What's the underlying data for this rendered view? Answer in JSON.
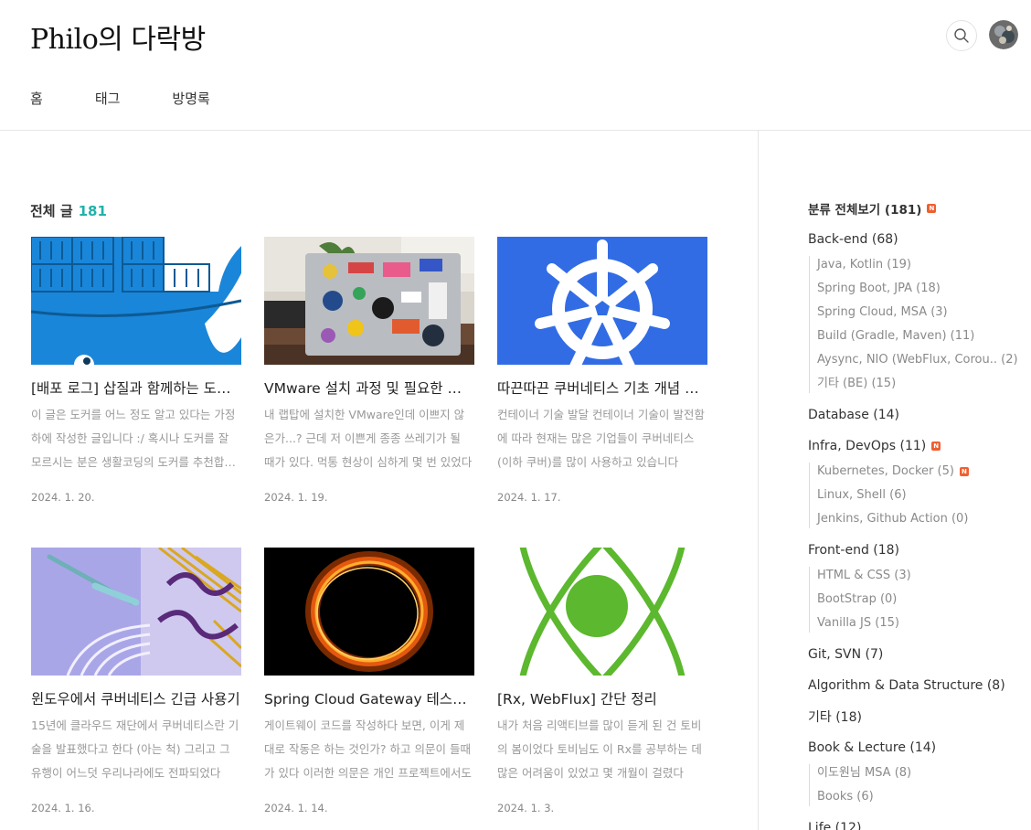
{
  "header": {
    "blog_title": "Philo의 다락방",
    "nav": [
      "홈",
      "태그",
      "방명록"
    ],
    "search_icon": "search-icon",
    "avatar_icon": "profile-avatar"
  },
  "main": {
    "all_posts_label": "전체 글",
    "all_posts_count": "181",
    "posts": [
      {
        "title": "[배포 로그] 삽질과 함께하는 도커 정리",
        "excerpt": "이 글은 도커를 어느 정도 알고 있다는 가정하에 작성한 글입니다 :/ 혹시나 도커를 잘 모르시는 분은 생활코딩의 도커를 추천합니다",
        "date": "2024. 1. 20.",
        "thumb": "docker-whale"
      },
      {
        "title": "VMware 설치 과정 및 필요한 설정 정리",
        "excerpt": "내 랩탑에 설치한 VMware인데 이쁘지 않은가...? 근데 저 이쁜게 종종 쓰레기가 될 때가 있다. 먹통 현상이 심하게 몇 번 있었다",
        "date": "2024. 1. 19.",
        "thumb": "laptop-stickers"
      },
      {
        "title": "따끈따끈 쿠버네티스 기초 개념 정리",
        "excerpt": "컨테이너 기술 발달 컨테이너 기술이 발전함에 따라 현재는 많은 기업들이 쿠버네티스(이하 쿠버)를 많이 사용하고 있습니다",
        "date": "2024. 1. 17.",
        "thumb": "kubernetes-wheel"
      },
      {
        "title": "윈도우에서 쿠버네티스 긴급 사용기",
        "excerpt": "15년에 클라우드 재단에서 쿠버네티스란 기술을 발표했다고 한다 (아는 척) 그리고 그 유행이 어느덧 우리나라에도 전파되었다",
        "date": "2024. 1. 16.",
        "thumb": "abstract-purple"
      },
      {
        "title": "Spring Cloud Gateway 테스트 코드 작성기",
        "excerpt": "게이트웨이 코드를 작성하다 보면, 이게 제대로 작동은 하는 것인가? 하고 의문이 들때가 있다 이러한 의문은 개인 프로젝트에서도",
        "date": "2024. 1. 14.",
        "thumb": "fire-ring"
      },
      {
        "title": "[Rx, WebFlux] 간단 정리",
        "excerpt": "내가 처음 리액티브를 많이 듣게 된 건 토비의 봄이었다 토비님도 이 Rx를 공부하는 데 많은 어려움이 있었고 몇 개월이 걸렸다",
        "date": "2024. 1. 3.",
        "thumb": "reactive-atom"
      }
    ]
  },
  "sidebar": {
    "all_label": "분류 전체보기 (181)",
    "badge": "N",
    "groups": [
      {
        "label": "Back-end (68)",
        "new": false,
        "subs": [
          {
            "label": "Java, Kotlin (19)",
            "new": false
          },
          {
            "label": "Spring Boot, JPA (18)",
            "new": false
          },
          {
            "label": "Spring Cloud, MSA (3)",
            "new": false
          },
          {
            "label": "Build (Gradle, Maven) (11)",
            "new": false
          },
          {
            "label": "Aysync, NIO (WebFlux, Corou.. (2)",
            "new": false
          },
          {
            "label": "기타 (BE) (15)",
            "new": false
          }
        ]
      },
      {
        "label": "Database (14)",
        "new": false,
        "subs": []
      },
      {
        "label": "Infra, DevOps (11)",
        "new": true,
        "subs": [
          {
            "label": "Kubernetes, Docker (5)",
            "new": true
          },
          {
            "label": "Linux, Shell (6)",
            "new": false
          },
          {
            "label": "Jenkins, Github Action (0)",
            "new": false
          }
        ]
      },
      {
        "label": "Front-end (18)",
        "new": false,
        "subs": [
          {
            "label": "HTML & CSS (3)",
            "new": false
          },
          {
            "label": "BootStrap (0)",
            "new": false
          },
          {
            "label": "Vanilla JS (15)",
            "new": false
          }
        ]
      },
      {
        "label": "Git, SVN (7)",
        "new": false,
        "subs": []
      },
      {
        "label": "Algorithm & Data Structure (8)",
        "new": false,
        "subs": []
      },
      {
        "label": "기타 (18)",
        "new": false,
        "subs": []
      },
      {
        "label": "Book & Lecture (14)",
        "new": false,
        "subs": [
          {
            "label": "이도원님 MSA (8)",
            "new": false
          },
          {
            "label": "Books (6)",
            "new": false
          }
        ]
      },
      {
        "label": "Life (12)",
        "new": false,
        "subs": []
      }
    ]
  },
  "colors": {
    "accent_count": "#20b2aa",
    "new_badge": "#ef5f2f",
    "docker_blue": "#1d8fe0",
    "k8s_blue": "#326ce5",
    "reactive_green": "#5cb82e"
  }
}
